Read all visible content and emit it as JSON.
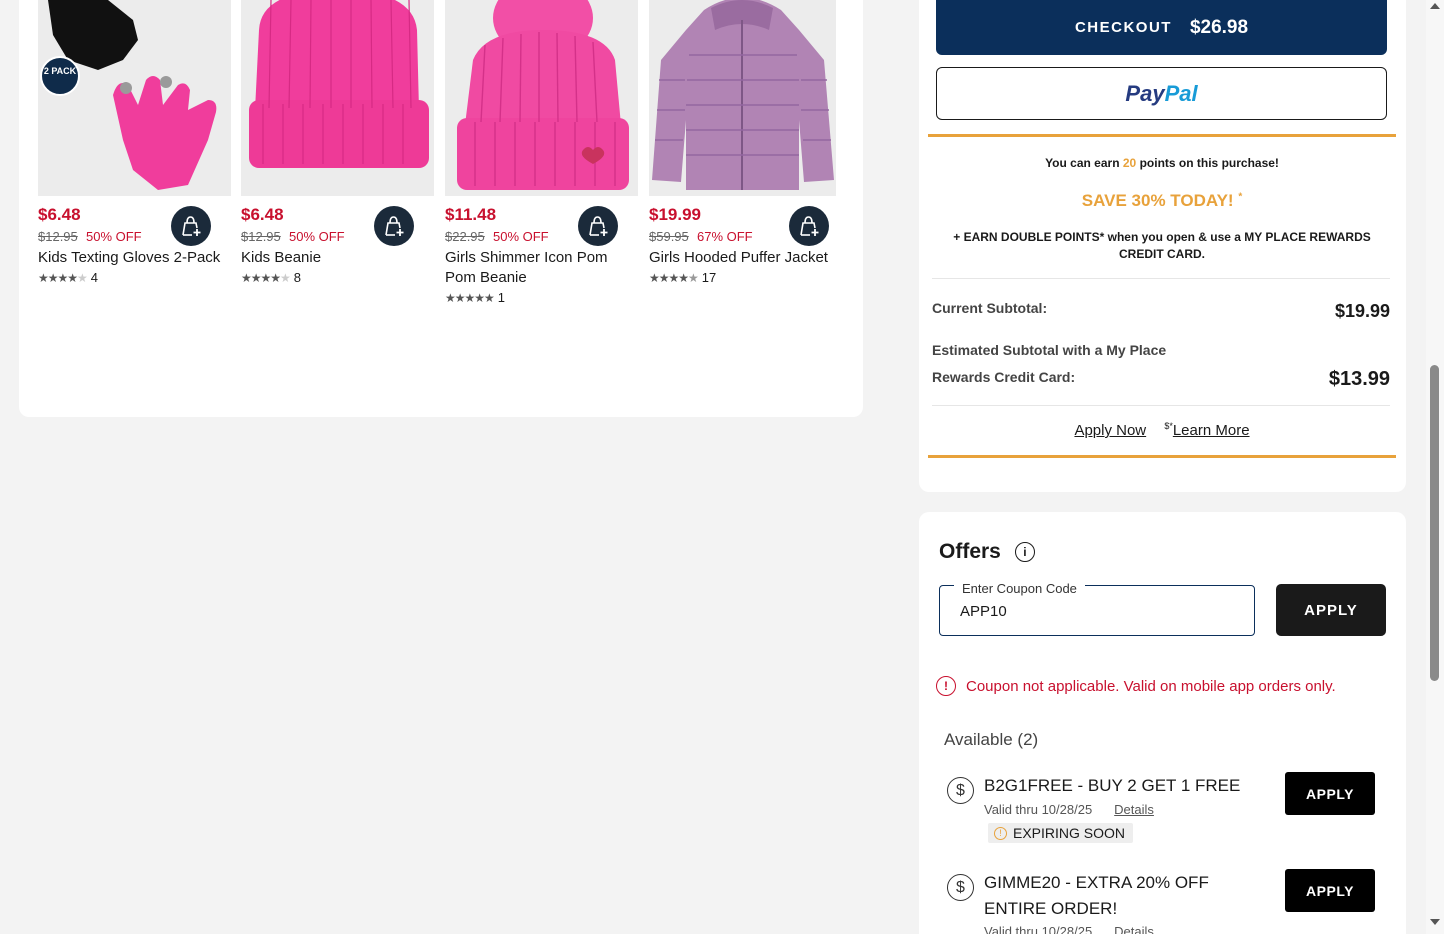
{
  "products": [
    {
      "name": "Kids Texting Gloves 2-Pack",
      "price": "$6.48",
      "was": "$12.95",
      "off": "50% OFF",
      "rating_count": "4",
      "badge": "2 PACK",
      "stars": 4
    },
    {
      "name": "Kids Beanie",
      "price": "$6.48",
      "was": "$12.95",
      "off": "50% OFF",
      "rating_count": "8",
      "stars": 4
    },
    {
      "name": "Girls Shimmer Icon Pom Pom Beanie",
      "price": "$11.48",
      "was": "$22.95",
      "off": "50% OFF",
      "rating_count": "1",
      "stars": 5
    },
    {
      "name": "Girls Hooded Puffer Jacket",
      "price": "$19.99",
      "was": "$59.95",
      "off": "67% OFF",
      "rating_count": "17",
      "stars": 4.5
    }
  ],
  "checkout": {
    "label": "CHECKOUT",
    "amount": "$26.98"
  },
  "paypal": {
    "pay": "Pay",
    "pal": "Pal"
  },
  "rewards": {
    "earn_prefix": "You can earn",
    "earn_points": "20",
    "earn_suffix": "points on this purchase!",
    "save": "SAVE 30% TODAY!",
    "save_mark": "*",
    "double": "+ EARN DOUBLE POINTS* when you open & use a MY PLACE REWARDS CREDIT CARD.",
    "current_label": "Current Subtotal:",
    "current_value": "$19.99",
    "est_label_1": "Estimated Subtotal with a My Place",
    "est_label_2": "Rewards Credit Card:",
    "est_value": "$13.99",
    "apply_now": "Apply Now",
    "learn_mark": "$*",
    "learn_more": "Learn More"
  },
  "offers": {
    "title": "Offers",
    "coupon_label": "Enter Coupon Code",
    "coupon_value": "APP10",
    "apply": "APPLY",
    "error": "Coupon not applicable. Valid on mobile app orders only.",
    "available": "Available (2)",
    "items": [
      {
        "title": "B2G1FREE - BUY 2 GET 1 FREE",
        "valid": "Valid thru 10/28/25",
        "details": "Details",
        "apply": "APPLY",
        "tag": "EXPIRING SOON"
      },
      {
        "title": "GIMME20 - EXTRA 20% OFF ENTIRE ORDER!",
        "valid": "Valid thru 10/28/25",
        "details": "Details",
        "apply": "APPLY"
      }
    ]
  },
  "colors": {
    "brand_navy": "#0b2f5b",
    "sale_red": "#c8102e",
    "rewards_orange": "#e8a23b",
    "product_pink": "#f0479e"
  }
}
